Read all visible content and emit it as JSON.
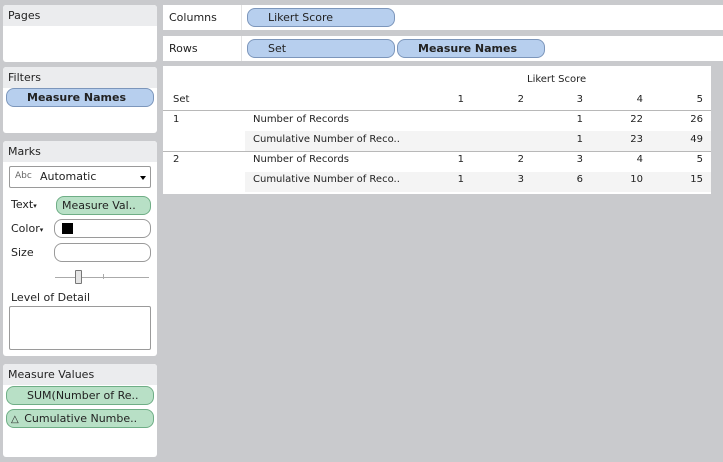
{
  "pages": {
    "title": "Pages"
  },
  "filters": {
    "title": "Filters",
    "pill": "Measure Names"
  },
  "marks": {
    "title": "Marks",
    "mark_type_prefix": "Abc",
    "mark_type": "Automatic",
    "text_label": "Text",
    "text_pill": "Measure Val..",
    "color_label": "Color",
    "size_label": "Size",
    "detail_label": "Level of Detail"
  },
  "measure_values": {
    "title": "Measure Values",
    "items": [
      "SUM(Number of Re..",
      "Cumulative Numbe.."
    ]
  },
  "shelves": {
    "columns_label": "Columns",
    "columns_pill": "Likert Score",
    "rows_label": "Rows",
    "rows_pills": [
      "Set",
      "Measure Names"
    ]
  },
  "table": {
    "column_header": "Likert Score",
    "set_header": "Set",
    "columns": [
      "1",
      "2",
      "3",
      "4",
      "5"
    ],
    "rows": [
      {
        "set": "1",
        "measure": "Number of Records",
        "values": [
          "",
          "",
          "1",
          "22",
          "26"
        ]
      },
      {
        "set": "",
        "measure": "Cumulative Number of Reco..",
        "values": [
          "",
          "",
          "1",
          "23",
          "49"
        ]
      },
      {
        "set": "2",
        "measure": "Number of Records",
        "values": [
          "1",
          "2",
          "3",
          "4",
          "5"
        ]
      },
      {
        "set": "",
        "measure": "Cumulative Number of Reco..",
        "values": [
          "1",
          "3",
          "6",
          "10",
          "15"
        ]
      }
    ]
  },
  "colors": {
    "blue_pill": "#b7cfee",
    "green_pill": "#b8e0c6",
    "background": "#c9cacd"
  }
}
